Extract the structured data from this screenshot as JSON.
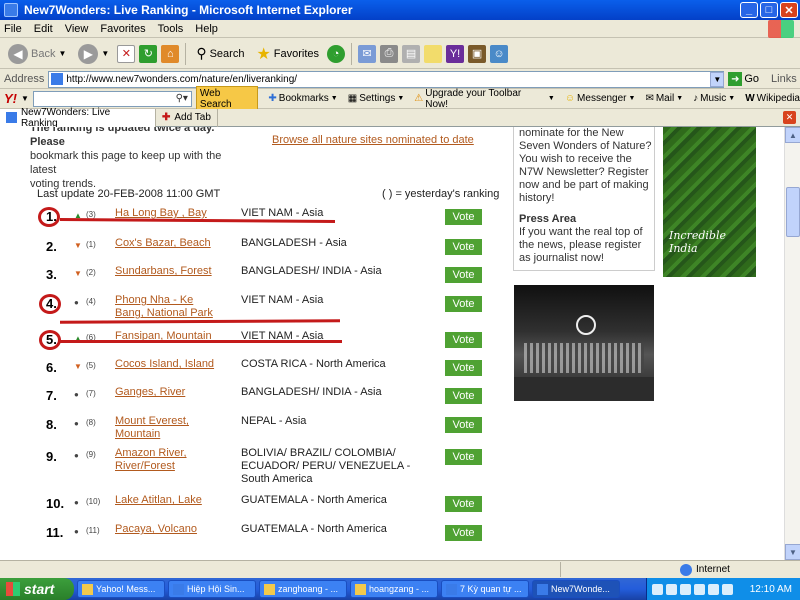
{
  "window": {
    "title": "New7Wonders: Live Ranking - Microsoft Internet Explorer"
  },
  "menubar": [
    "File",
    "Edit",
    "View",
    "Favorites",
    "Tools",
    "Help"
  ],
  "toolbar": {
    "back": "Back",
    "search": "Search",
    "favorites": "Favorites"
  },
  "address": {
    "label": "Address",
    "url": "http://www.new7wonders.com/nature/en/liveranking/",
    "go": "Go",
    "links": "Links"
  },
  "yahoo": {
    "logo": "Y!",
    "web_search": "Web Search",
    "items": [
      "Bookmarks",
      "Settings",
      "Upgrade your Toolbar Now!",
      "Messenger",
      "Mail",
      "Music",
      "Wikipedia"
    ]
  },
  "tabs": {
    "active": "New7Wonders: Live Ranking",
    "add": "Add Tab"
  },
  "page": {
    "intro_line1": "The ranking is updated twice a day. Please",
    "intro_line2": "bookmark this page to keep up with the latest",
    "intro_line3": "voting trends.",
    "browse_link": "Browse all nature sites nominated to date",
    "last_update": "Last update 20-FEB-2008 11:00 GMT",
    "legend_note": "( ) = yesterday's ranking",
    "vote_label": "Vote",
    "rankings": [
      {
        "rank": "1.",
        "trend": "up",
        "prev": "(3)",
        "site": "Ha Long Bay , Bay",
        "country": "VIET NAM - Asia"
      },
      {
        "rank": "2.",
        "trend": "down",
        "prev": "(1)",
        "site": "Cox's Bazar, Beach",
        "country": "BANGLADESH - Asia"
      },
      {
        "rank": "3.",
        "trend": "down",
        "prev": "(2)",
        "site": "Sundarbans, Forest",
        "country": "BANGLADESH/ INDIA - Asia"
      },
      {
        "rank": "4.",
        "trend": "same",
        "prev": "(4)",
        "site": "Phong Nha - Ke Bang, National Park",
        "country": "VIET NAM - Asia"
      },
      {
        "rank": "5.",
        "trend": "up",
        "prev": "(6)",
        "site": "Fansipan, Mountain",
        "country": "VIET NAM - Asia"
      },
      {
        "rank": "6.",
        "trend": "down",
        "prev": "(5)",
        "site": "Cocos Island, Island",
        "country": "COSTA RICA - North America"
      },
      {
        "rank": "7.",
        "trend": "same",
        "prev": "(7)",
        "site": "Ganges, River",
        "country": "BANGLADESH/ INDIA - Asia"
      },
      {
        "rank": "8.",
        "trend": "same",
        "prev": "(8)",
        "site": "Mount Everest, Mountain",
        "country": "NEPAL - Asia"
      },
      {
        "rank": "9.",
        "trend": "same",
        "prev": "(9)",
        "site": "Amazon River, River/Forest",
        "country": "BOLIVIA/ BRAZIL/ COLOMBIA/ ECUADOR/ PERU/ VENEZUELA - South America"
      },
      {
        "rank": "10.",
        "trend": "same",
        "prev": "(10)",
        "site": "Lake Atitlan, Lake",
        "country": "GUATEMALA - North America"
      },
      {
        "rank": "11.",
        "trend": "same",
        "prev": "(11)",
        "site": "Pacaya, Volcano",
        "country": "GUATEMALA - North America"
      }
    ],
    "sidebar": {
      "newsletter": "nominate for the New Seven Wonders of Nature? You wish to receive the N7W Newsletter? Register now and be part of making history!",
      "press_title": "Press Area",
      "press_text": "If you want the real top of the news, please register as journalist now!",
      "ad_caption": "Incredible India"
    }
  },
  "status": {
    "zone": "Internet"
  },
  "taskbar": {
    "start": "start",
    "tasks": [
      "Yahoo! Mess...",
      "Hiệp Hội Sin...",
      "zanghoang - ...",
      "hoangzang - ...",
      "7 Kỳ quan tự ...",
      "New7Wonde..."
    ],
    "clock": "12:10 AM"
  },
  "colors": {
    "link": "#B25A1E",
    "vote_bg": "#4FA233",
    "annotation": "#C41A1A"
  }
}
